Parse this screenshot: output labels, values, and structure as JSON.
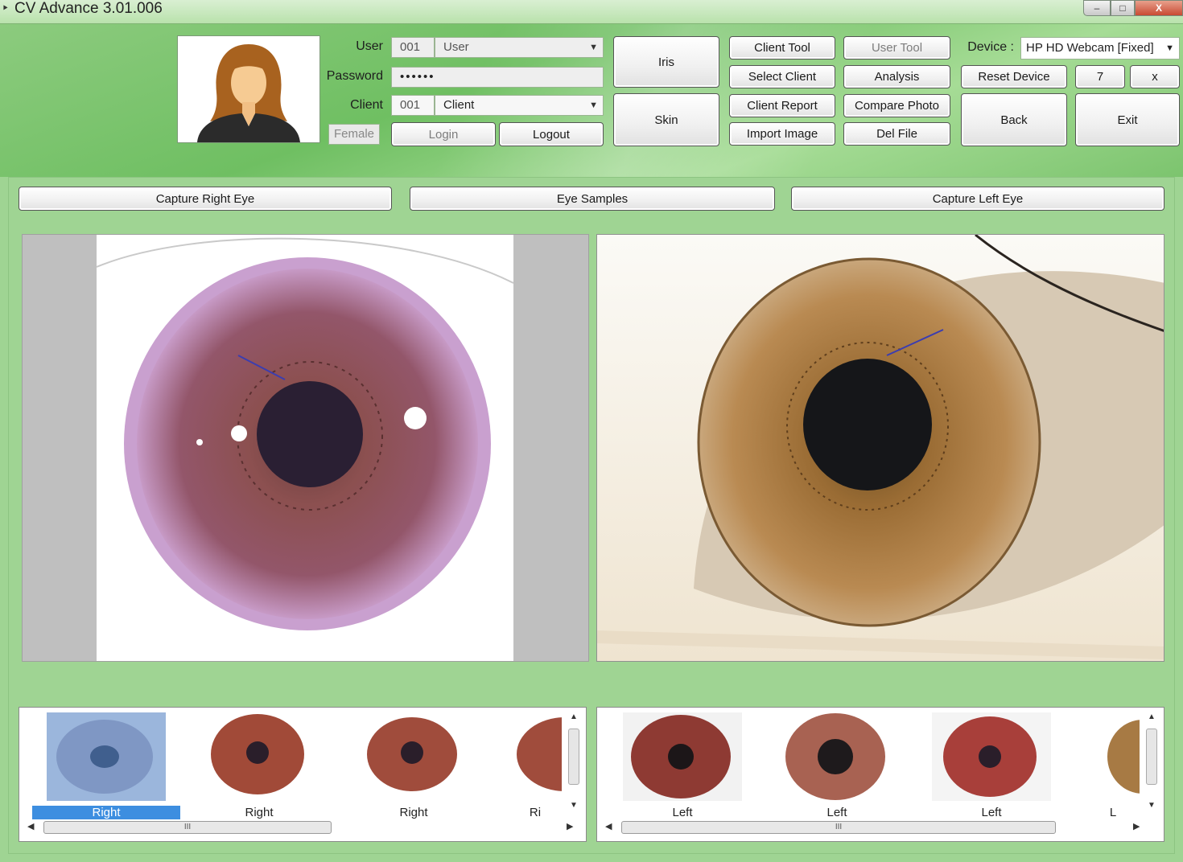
{
  "window": {
    "title": "CV Advance 3.01.006",
    "minimize": "‒",
    "maximize": "□",
    "close": "X"
  },
  "login": {
    "user_label": "User",
    "user_id": "001",
    "user_name": "User",
    "password_label": "Password",
    "password_value": "••••••",
    "client_label": "Client",
    "client_id": "001",
    "client_name": "Client",
    "gender": "Female",
    "login_label": "Login",
    "logout_label": "Logout"
  },
  "toolbar": {
    "iris": "Iris",
    "skin": "Skin",
    "client_tool": "Client Tool",
    "user_tool": "User Tool",
    "select_client": "Select Client",
    "analysis": "Analysis",
    "client_report": "Client Report",
    "compare_photo": "Compare Photo",
    "import_image": "Import Image",
    "del_file": "Del File",
    "device_label": "Device :",
    "device_value": "HP HD Webcam [Fixed]",
    "reset_device": "Reset Device",
    "count": "7",
    "x": "x",
    "back": "Back",
    "exit": "Exit"
  },
  "capture": {
    "right": "Capture Right Eye",
    "samples": "Eye Samples",
    "left": "Capture Left Eye"
  },
  "thumbnails": {
    "right": [
      {
        "label": "Right",
        "selected": true
      },
      {
        "label": "Right"
      },
      {
        "label": "Right"
      },
      {
        "label": "Ri"
      }
    ],
    "left": [
      {
        "label": "Left"
      },
      {
        "label": "Left"
      },
      {
        "label": "Left"
      },
      {
        "label": "L"
      }
    ],
    "scroll_grip": "III"
  },
  "colors": {
    "background": "#9fd493",
    "selected_label": "#3d8ee0"
  }
}
